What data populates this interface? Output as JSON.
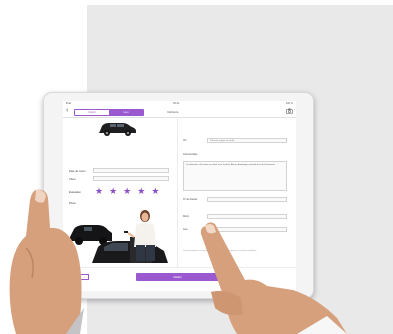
{
  "status_bar": {
    "carrier": "iPad",
    "time": "09:41",
    "battery": "100 %"
  },
  "nav": {
    "back_glyph": "‹",
    "tabs": [
      {
        "label": "Dépôt",
        "active": false
      },
      {
        "label": "Lieu",
        "active": true
      }
    ],
    "title": "Véhicule",
    "camera_icon": "camera-icon"
  },
  "left_form": {
    "fields": [
      {
        "label": "Date de retour"
      },
      {
        "label": "Client"
      }
    ],
    "rating_label": "Évaluation",
    "rating": 5,
    "rating_max": 5,
    "photo_label": "Photo"
  },
  "right_form": {
    "vin_label": "Vin",
    "vin_value": "Véhicule propre et vérifié",
    "comment_label": "Commentaire",
    "comment_text": "Le véhicule a été remis au client avec le plein. Aucun dommage constaté lors de la livraison.",
    "fields": [
      {
        "label": "N° de dossier"
      },
      {
        "label": "Kilom."
      },
      {
        "label": "Lieu"
      }
    ],
    "fine_print": "Le client confirme avoir reçu le véhicule dans l'état décrit ci-dessus et accepte les conditions."
  },
  "bottom": {
    "btn_a": "OK",
    "btn_b": "+",
    "save_label": "Valider"
  },
  "colors": {
    "accent": "#9b59d0",
    "star": "#8a4fc7"
  }
}
